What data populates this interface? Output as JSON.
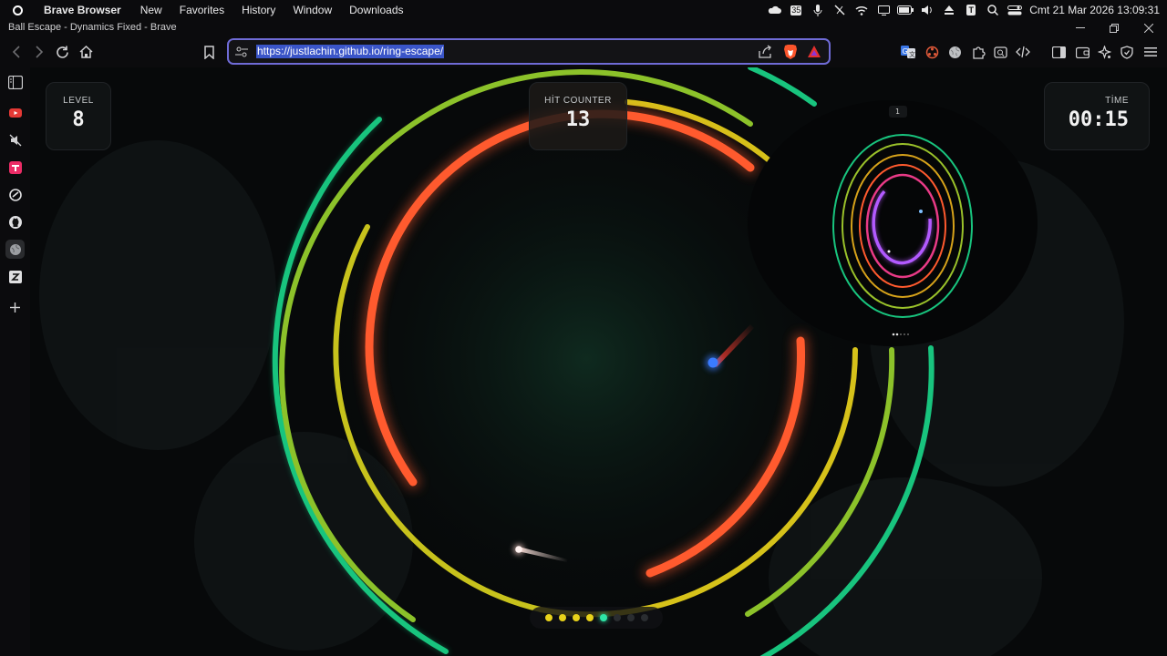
{
  "menubar": {
    "app_name": "Brave Browser",
    "items": [
      "New",
      "Favorites",
      "History",
      "Window",
      "Downloads"
    ],
    "status_badge": "35",
    "status_letter": "T",
    "clock": "Cmt 21 Mar 2026 13:09:31"
  },
  "window": {
    "title": "Ball Escape - Dynamics Fixed - Brave"
  },
  "toolbar": {
    "url": "https://justlachin.github.io/ring-escape/"
  },
  "hud": {
    "level_label": "LEVEL",
    "level_value": "8",
    "hits_label": "HİT COUNTER",
    "hits_value": "13",
    "time_label": "TİME",
    "time_value": "00:15"
  },
  "minimap": {
    "level_badge": "1"
  },
  "progress": {
    "completed": 5,
    "total": 8,
    "colors": {
      "done": "#e8d21a",
      "current": "#2ee6a6",
      "pending": "#2a2d30"
    }
  },
  "colors": {
    "accent": "#6f6bd6",
    "ring_orange": "#ff5a2e",
    "ring_yellow": "#d6c21a",
    "ring_lime": "#8cc22a",
    "ring_green": "#18c47e",
    "ball_blue": "#3a7bff"
  }
}
